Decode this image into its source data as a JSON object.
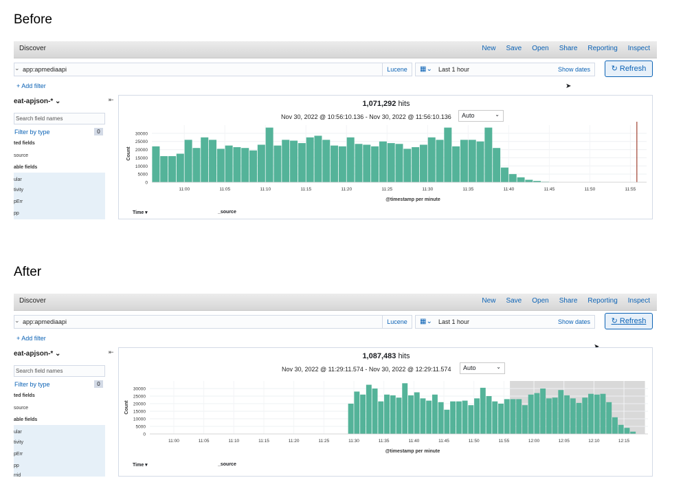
{
  "labels": {
    "before": "Before",
    "after": "After"
  },
  "common": {
    "app_title": "Discover",
    "menu": [
      "New",
      "Save",
      "Open",
      "Share",
      "Reporting",
      "Inspect"
    ],
    "query": "app:apmediaapi",
    "query_language": "Lucene",
    "time_range": "Last 1 hour",
    "show_dates": "Show dates",
    "refresh": "Refresh",
    "refresh_icon": "refresh-icon",
    "add_filter": "+ Add filter",
    "index_pattern": "eat-apjson-*",
    "search_placeholder": "Search field names",
    "filter_by_type": "Filter by type",
    "filter_count": "0",
    "selected_fields_title": "ted fields",
    "source_field": "source",
    "available_fields_title": "able fields",
    "fields": [
      "ular",
      "tivity",
      "pErr",
      "pp",
      "rrid"
    ],
    "table_time": "Time",
    "table_source": "_source",
    "interval_value": "Auto",
    "y_axis_label": "Count",
    "x_axis_label": "@timestamp per minute",
    "bar_color": "#54b399"
  },
  "before": {
    "hits_count": "1,071,292",
    "hits_word": "hits",
    "date_range": "Nov 30, 2022 @ 10:56:10.136 - Nov 30, 2022 @ 11:56:10.136"
  },
  "after": {
    "hits_count": "1,087,483",
    "hits_word": "hits",
    "date_range": "Nov 30, 2022 @ 11:29:11.574 - Nov 30, 2022 @ 12:29:11.574"
  },
  "chart_data": [
    {
      "type": "bar",
      "title": "Before",
      "xlabel": "@timestamp per minute",
      "ylabel": "Count",
      "ylim": [
        0,
        35000
      ],
      "yticks": [
        0,
        5000,
        10000,
        15000,
        20000,
        25000,
        30000
      ],
      "xtick_labels": [
        "11:00",
        "11:05",
        "11:10",
        "11:15",
        "11:20",
        "11:25",
        "11:30",
        "11:35",
        "11:40",
        "11:45",
        "11:50",
        "11:55"
      ],
      "x_start_minute": -4,
      "x_end_minute": 57,
      "bar_start_minute": -4,
      "values": [
        22000,
        16000,
        16000,
        17500,
        26000,
        21000,
        27500,
        26000,
        20500,
        22500,
        21500,
        21000,
        19500,
        23000,
        33500,
        22500,
        26000,
        25500,
        24000,
        27500,
        28500,
        26000,
        22500,
        22000,
        27500,
        23500,
        23000,
        22000,
        25000,
        24000,
        23500,
        20500,
        21500,
        23000,
        27500,
        26000,
        33500,
        22000,
        26000,
        26000,
        25000,
        33500,
        21000,
        9000,
        5000,
        3000,
        1500,
        800,
        300,
        100
      ],
      "marker_minute": 55.8
    },
    {
      "type": "bar",
      "title": "After",
      "xlabel": "@timestamp per minute",
      "ylabel": "Count",
      "ylim": [
        0,
        35000
      ],
      "yticks": [
        0,
        5000,
        10000,
        15000,
        20000,
        25000,
        30000
      ],
      "xtick_labels": [
        "11:00",
        "11:05",
        "11:10",
        "11:15",
        "11:20",
        "11:25",
        "11:30",
        "11:35",
        "11:40",
        "11:45",
        "11:50",
        "11:55",
        "12:00",
        "12:05",
        "12:10",
        "12:15"
      ],
      "x_start_minute": -4,
      "x_end_minute": 79,
      "bar_start_minute": 29,
      "values": [
        20000,
        28000,
        26000,
        32500,
        30000,
        21500,
        26000,
        25500,
        24000,
        33500,
        25500,
        27500,
        23500,
        22000,
        26000,
        21000,
        16000,
        21500,
        21500,
        22000,
        19000,
        23500,
        30500,
        25000,
        21500,
        20000,
        23000,
        23000,
        23000,
        19000,
        26000,
        27000,
        30000,
        23500,
        24000,
        29000,
        25500,
        23500,
        20500,
        24000,
        26500,
        26000,
        26500,
        21000,
        11000,
        6000,
        4000,
        1500
      ],
      "shaded_from_minute": 56,
      "shaded_to_minute": 78.5
    }
  ]
}
